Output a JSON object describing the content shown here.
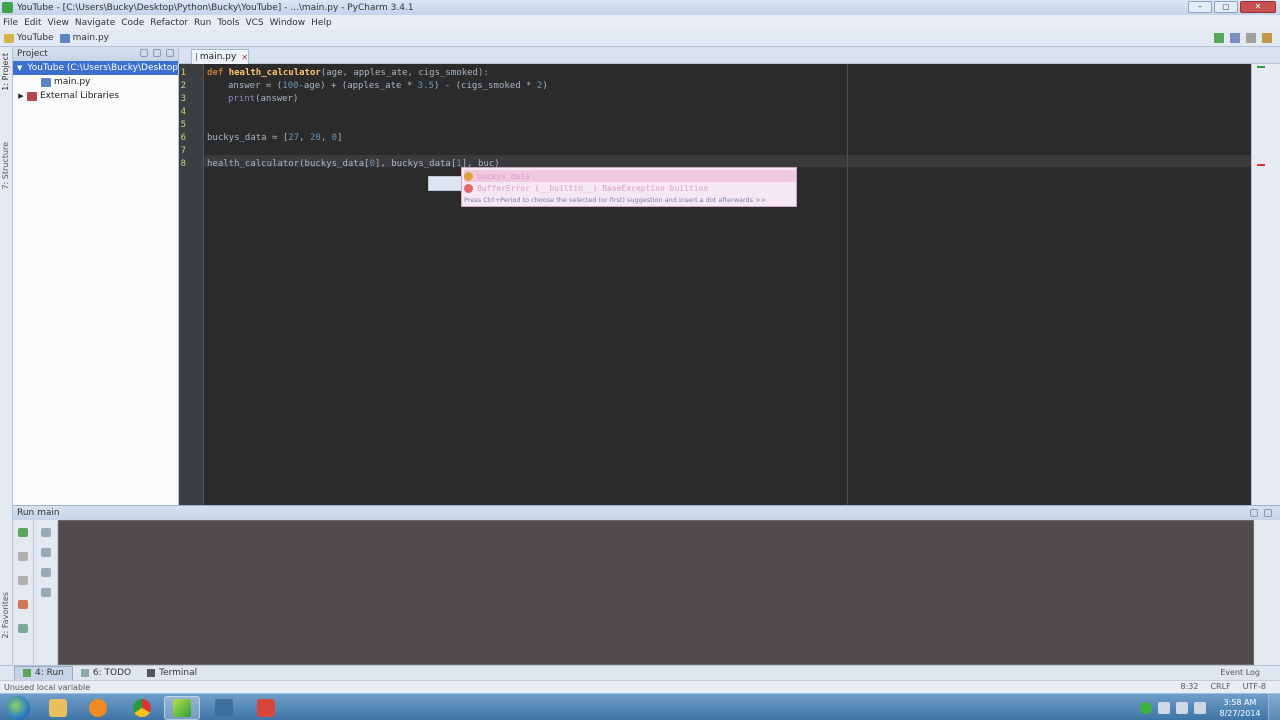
{
  "window": {
    "title": "YouTube - [C:\\Users\\Bucky\\Desktop\\Python\\Bucky\\YouTube] - ...\\main.py - PyCharm 3.4.1",
    "controls": [
      "–",
      "▢",
      "✕"
    ]
  },
  "menu": [
    "File",
    "Edit",
    "View",
    "Navigate",
    "Code",
    "Refactor",
    "Run",
    "Tools",
    "VCS",
    "Window",
    "Help"
  ],
  "nav": {
    "crumbs": [
      "YouTube",
      "main.py"
    ]
  },
  "sidebar_left": {
    "project_label": "1: Project",
    "structure_label": "7: Structure",
    "favorites_label": "2: Favorites"
  },
  "project": {
    "header": "Project",
    "tree": [
      {
        "label": "YouTube (C:\\Users\\Bucky\\Desktop\\Py",
        "icon": "folder-icon"
      },
      {
        "label": "main.py",
        "icon": "python-file-icon"
      },
      {
        "label": "External Libraries",
        "icon": "library-icon"
      }
    ]
  },
  "editor": {
    "tab": "main.py",
    "lines": [
      1,
      2,
      3,
      4,
      5,
      6,
      7,
      8
    ],
    "code": {
      "l1": {
        "kw": "def",
        "fn": "health_calculator",
        "rest": "(age, apples_ate, cigs_smoked):"
      },
      "l2": {
        "a": "answer = (",
        "n1": "100",
        "b": "-age) + (apples_ate * ",
        "n2": "3.5",
        "c": ") - (cigs_smoked * ",
        "n3": "2",
        "d": ")"
      },
      "l3": {
        "bi": "print",
        "rest": "(answer)"
      },
      "l6": {
        "a": "buckys_data = [",
        "n1": "27",
        "b": ", ",
        "n2": "20",
        "c": ", ",
        "n3": "0",
        "d": "]"
      },
      "l8": {
        "a": "health_calculator(buckys_data[",
        "n1": "0",
        "b": "], buckys_data[",
        "n2": "1",
        "c": "], buc)"
      }
    }
  },
  "autocomplete": {
    "items": [
      "buckys_data",
      "BufferError (__builtin__)  BaseException  builtins"
    ],
    "hint": "Press Ctrl+Period to choose the selected (or first) suggestion and insert a dot afterwards >>"
  },
  "run": {
    "header": "Run  main",
    "tab": "4: Run",
    "todo": "6: TODO",
    "terminal": "Terminal",
    "event_log": "Event Log"
  },
  "status": {
    "left": "Unused local variable",
    "position": "8:32",
    "line_sep": "CRLF",
    "encoding": "UTF-8"
  },
  "taskbar": {
    "apps": [
      "explorer",
      "media-player",
      "chrome",
      "pycharm",
      "app-5",
      "app-6"
    ],
    "time": "3:58 AM",
    "date": "8/27/2014"
  },
  "colors": {
    "editor_bg": "#2b2b2b",
    "keyword": "#cc7832",
    "function": "#ffc66d",
    "number": "#6897bb",
    "builtin": "#8888c6",
    "console_bg": "#504c4c"
  }
}
